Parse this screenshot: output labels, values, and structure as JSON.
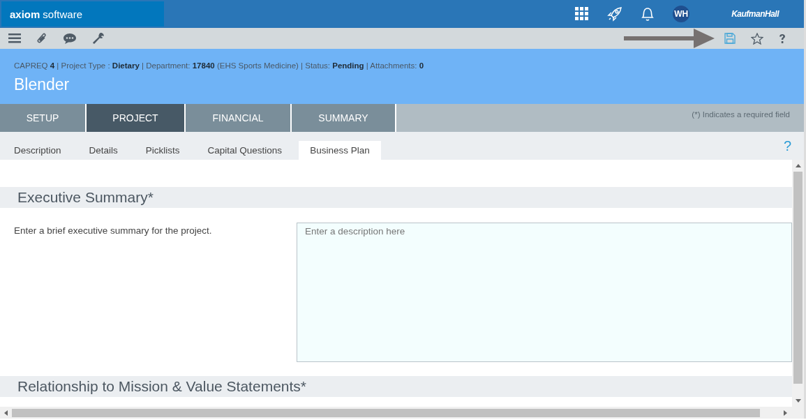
{
  "header": {
    "brand_bold": "axiom",
    "brand_rest": "software",
    "avatar": "WH",
    "partner": "KaufmanHall"
  },
  "record": {
    "info": "CAPREQ **4** | Project Type : **Dietary** | Department: **17840** (EHS Sports Medicine) | Status: **Pending** | Attachments: **0**",
    "title": "Blender"
  },
  "main_tabs": [
    {
      "label": "SETUP",
      "selected": false
    },
    {
      "label": "PROJECT",
      "selected": true
    },
    {
      "label": "FINANCIAL",
      "selected": false
    },
    {
      "label": "SUMMARY",
      "selected": false
    }
  ],
  "required_note": "(*) Indicates a required field",
  "sub_tabs": [
    {
      "label": "Description",
      "selected": false
    },
    {
      "label": "Details",
      "selected": false
    },
    {
      "label": "Picklists",
      "selected": false
    },
    {
      "label": "Capital Questions",
      "selected": false
    },
    {
      "label": "Business Plan",
      "selected": true
    }
  ],
  "help": "?",
  "sections": [
    {
      "title": "Executive Summary*",
      "prompt": "Enter a brief executive summary for the project.",
      "placeholder": "Enter a description here"
    },
    {
      "title": "Relationship to Mission & Value Statements*"
    }
  ]
}
